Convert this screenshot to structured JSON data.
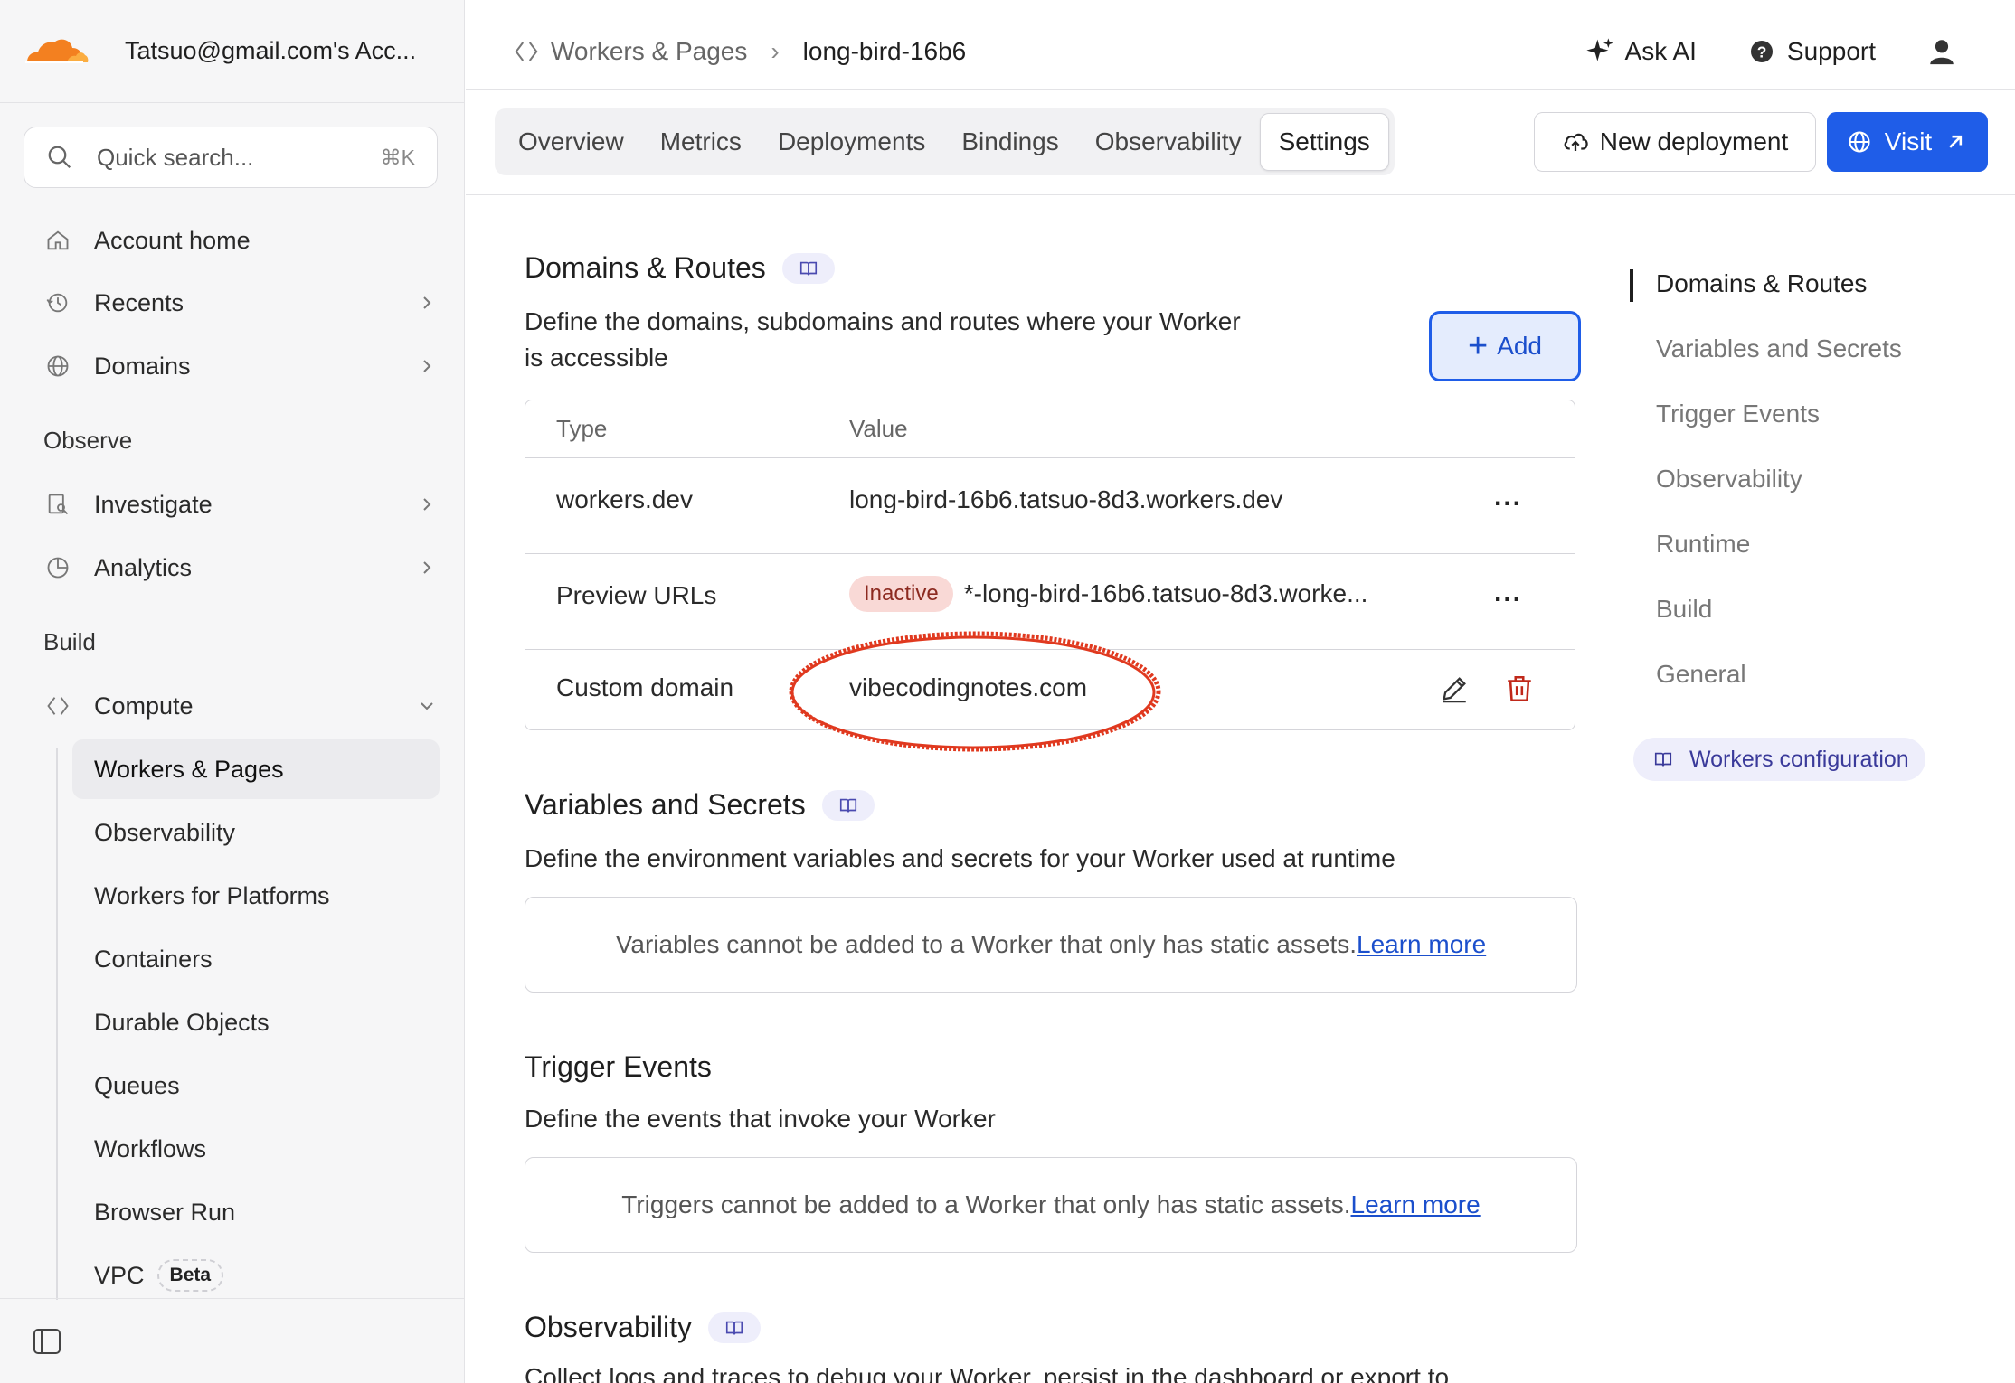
{
  "account": {
    "name": "Tatsuo@gmail.com's Acc..."
  },
  "search": {
    "placeholder": "Quick search...",
    "shortcut": "⌘K"
  },
  "sidebar": {
    "top_items": [
      {
        "label": "Account home",
        "icon": "home-icon"
      },
      {
        "label": "Recents",
        "icon": "history-icon"
      },
      {
        "label": "Domains",
        "icon": "globe-icon"
      }
    ],
    "observe_heading": "Observe",
    "observe_items": [
      {
        "label": "Investigate",
        "icon": "investigate-icon"
      },
      {
        "label": "Analytics",
        "icon": "pie-chart-icon"
      }
    ],
    "build_heading": "Build",
    "compute_label": "Compute",
    "compute_items": [
      "Workers & Pages",
      "Observability",
      "Workers for Platforms",
      "Containers",
      "Durable Objects",
      "Queues",
      "Workflows",
      "Browser Run",
      "VPC"
    ],
    "vpc_badge": "Beta"
  },
  "breadcrumb": {
    "parent": "Workers & Pages",
    "current": "long-bird-16b6"
  },
  "topbar": {
    "ask_ai": "Ask AI",
    "support": "Support"
  },
  "tabs": [
    "Overview",
    "Metrics",
    "Deployments",
    "Bindings",
    "Observability",
    "Settings"
  ],
  "active_tab": "Settings",
  "actions": {
    "new_deployment": "New deployment",
    "visit": "Visit"
  },
  "domains": {
    "title": "Domains & Routes",
    "desc_line1": "Define the domains, subdomains and routes where your Worker",
    "desc_line2": "is accessible",
    "add_label": "Add",
    "col_type": "Type",
    "col_value": "Value",
    "rows": [
      {
        "type": "workers.dev",
        "value": "long-bird-16b6.tatsuo-8d3.workers.dev"
      },
      {
        "type": "Preview URLs",
        "badge": "Inactive",
        "value": "*-long-bird-16b6.tatsuo-8d3.worke..."
      },
      {
        "type": "Custom domain",
        "value": "vibecodingnotes.com"
      }
    ],
    "more_label": "..."
  },
  "variables": {
    "title": "Variables and Secrets",
    "desc": "Define the environment variables and secrets for your Worker used at runtime",
    "empty": "Variables cannot be added to a Worker that only has static assets.",
    "learn_more": "Learn more"
  },
  "triggers": {
    "title": "Trigger Events",
    "desc": "Define the events that invoke your Worker",
    "empty": "Triggers cannot be added to a Worker that only has static assets.",
    "learn_more": "Learn more"
  },
  "observability": {
    "title": "Observability",
    "desc": "Collect logs and traces to debug your Worker, persist in the dashboard or export to"
  },
  "toc": {
    "items": [
      "Domains & Routes",
      "Variables and Secrets",
      "Trigger Events",
      "Observability",
      "Runtime",
      "Build",
      "General"
    ],
    "chip": "Workers configuration"
  },
  "colors": {
    "accent": "#1f5de8",
    "annotation": "#e0391f",
    "inactive_bg": "#f9d9d6"
  }
}
